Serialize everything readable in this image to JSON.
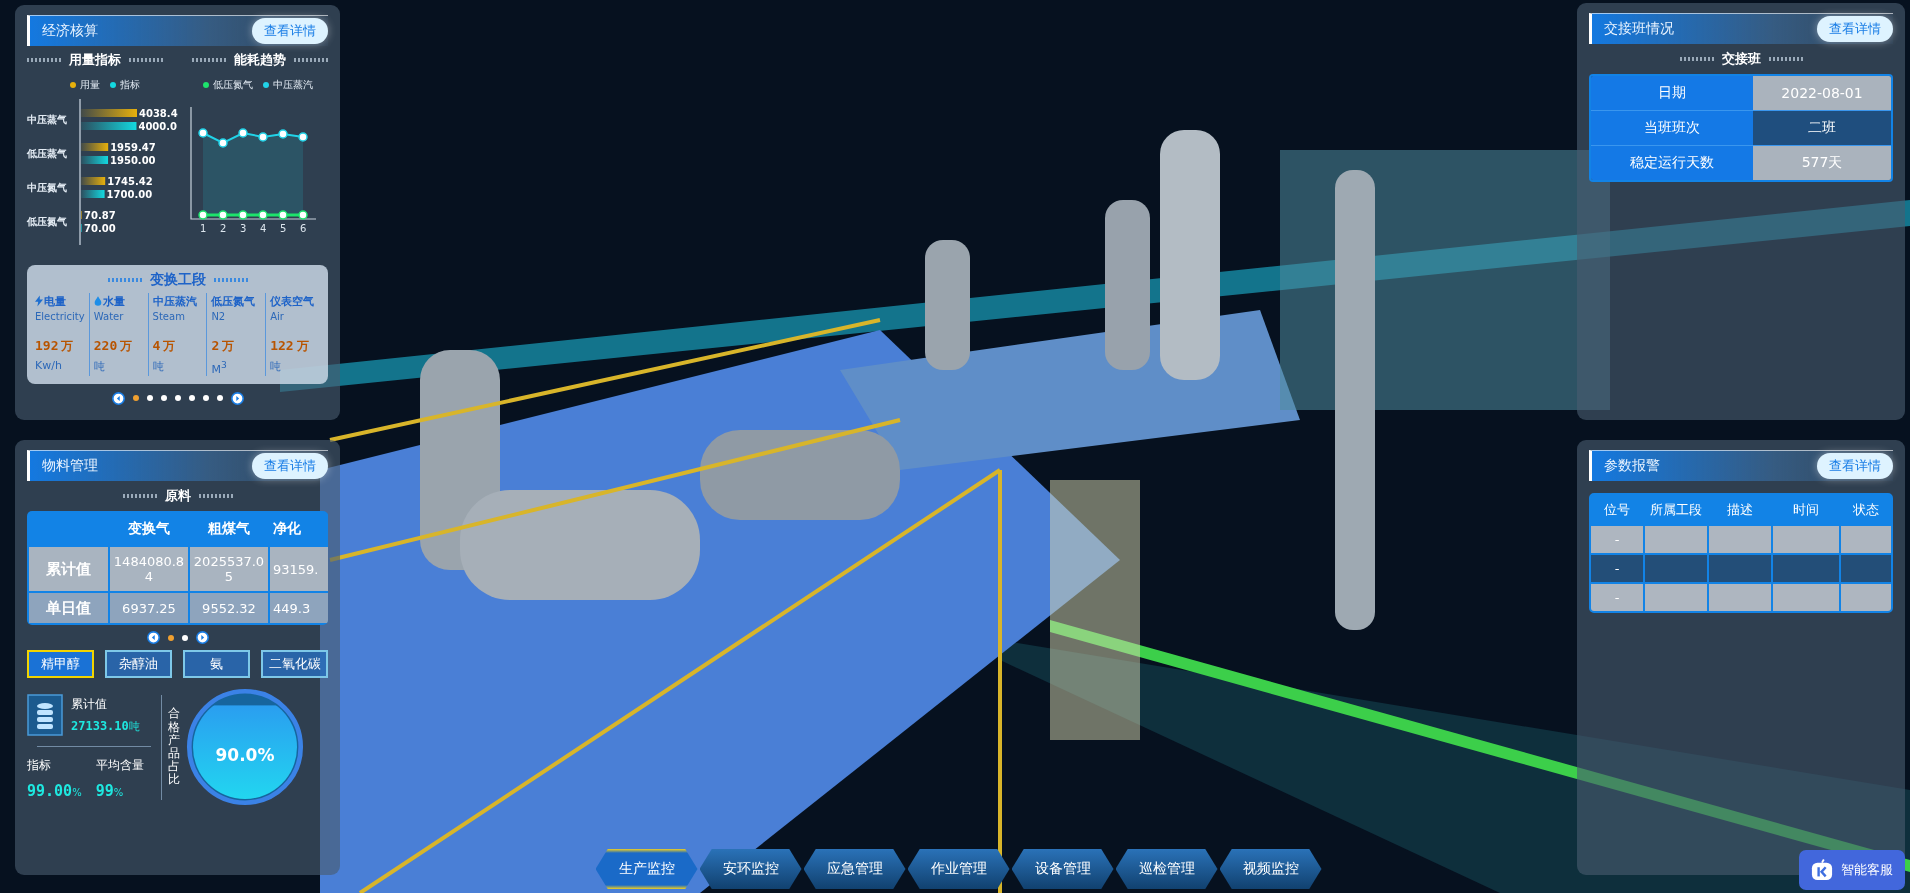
{
  "economics": {
    "title": "经济核算",
    "detail_button": "查看详情",
    "sections": [
      "用量指标",
      "能耗趋势"
    ],
    "usage_chart": {
      "chart_data": {
        "type": "bar",
        "orientation": "horizontal",
        "categories": [
          "中压蒸气",
          "低压蒸气",
          "中压氮气",
          "低压氮气"
        ],
        "series": [
          {
            "name": "用量",
            "color": "#e6b00c",
            "values": [
              4038.4,
              1959.47,
              1745.42,
              70.87
            ],
            "value_labels": [
              "4038.4",
              "1959.47",
              "1745.42",
              "70.87"
            ]
          },
          {
            "name": "指标",
            "color": "#13d8e0",
            "values": [
              4000.0,
              1950.0,
              1700.0,
              70.0
            ],
            "value_labels": [
              "4000.0",
              "1950.00",
              "1700.00",
              "70.00"
            ]
          }
        ],
        "data_labels": true
      }
    },
    "trend_chart": {
      "legend": [
        {
          "name": "低压氮气",
          "color": "#1de36c"
        },
        {
          "name": "中压蒸汽",
          "color": "#21d3e8"
        }
      ],
      "x_labels": [
        "1",
        "2",
        "3",
        "4",
        "5",
        "6"
      ]
    },
    "stage": {
      "title": "变换工段",
      "items": [
        {
          "kind": "electricity",
          "name": "电量",
          "en": "Electricity",
          "value": "192",
          "big_unit": "万",
          "unit": "Kw/h"
        },
        {
          "kind": "water",
          "name": "水量",
          "en": "Water",
          "value": "220",
          "big_unit": "万",
          "unit": "吨"
        },
        {
          "kind": "plain",
          "name": "中压蒸汽",
          "en": "Steam",
          "value": "4",
          "big_unit": "万",
          "unit": "吨"
        },
        {
          "kind": "plain",
          "name": "低压氮气",
          "en": "N2",
          "value": "2",
          "big_unit": "万",
          "unit": "M$^{3}$"
        },
        {
          "kind": "plain",
          "name": "仪表空气",
          "en": "Air",
          "value": "122",
          "big_unit": "万",
          "unit": "吨"
        }
      ]
    },
    "pager": [
      {
        "selected": true
      },
      {
        "selected": false
      },
      {
        "selected": false
      },
      {
        "selected": false
      },
      {
        "selected": false
      },
      {
        "selected": false
      },
      {
        "selected": false
      }
    ]
  },
  "materials": {
    "title": "物料管理",
    "detail_button": "查看详情",
    "section": "原料",
    "table": {
      "columns": [
        "变换气",
        "粗煤气",
        "净化"
      ],
      "rows": [
        {
          "label": "累计值",
          "cells": [
            "1484080.84",
            "2025537.05",
            "93159."
          ]
        },
        {
          "label": "单日值",
          "cells": [
            "6937.25",
            "9552.32",
            "449.3"
          ]
        }
      ]
    },
    "pager": [
      {
        "selected": true
      },
      {
        "selected": false
      }
    ],
    "products": [
      {
        "label": "精甲醇",
        "selected": true
      },
      {
        "label": "杂醇油",
        "selected": false
      },
      {
        "label": "氨",
        "selected": false
      },
      {
        "label": "二氧化碳",
        "selected": false
      }
    ],
    "total": {
      "label": "累计值",
      "value": "27133.10",
      "unit": "吨"
    },
    "stats": [
      {
        "label": "指标",
        "value": "99.00",
        "unit": "%"
      },
      {
        "label": "平均含量",
        "value": "99",
        "unit": "%"
      }
    ],
    "gauge": {
      "label": "合格产品占比",
      "reading": "90.0%",
      "level": 0.9
    }
  },
  "shift": {
    "title": "交接班情况",
    "detail_button": "查看详情",
    "section": "交接班",
    "rows": [
      {
        "label": "日期",
        "value": "2022-08-01"
      },
      {
        "label": "当班班次",
        "value": "二班"
      },
      {
        "label": "稳定运行天数",
        "value": "577天"
      }
    ]
  },
  "alarms": {
    "title": "参数报警",
    "detail_button": "查看详情",
    "columns": [
      "位号",
      "所属工段",
      "描述",
      "时间",
      "状态"
    ],
    "rows": [
      {
        "tag": "-"
      },
      {
        "tag": "-"
      },
      {
        "tag": "-"
      }
    ]
  },
  "nav": [
    {
      "label": "生产监控",
      "selected": true
    },
    {
      "label": "安环监控",
      "selected": false
    },
    {
      "label": "应急管理",
      "selected": false
    },
    {
      "label": "作业管理",
      "selected": false
    },
    {
      "label": "设备管理",
      "selected": false
    },
    {
      "label": "巡检管理",
      "selected": false
    },
    {
      "label": "视频监控",
      "selected": false
    }
  ],
  "assistant": {
    "label": "智能客服"
  }
}
